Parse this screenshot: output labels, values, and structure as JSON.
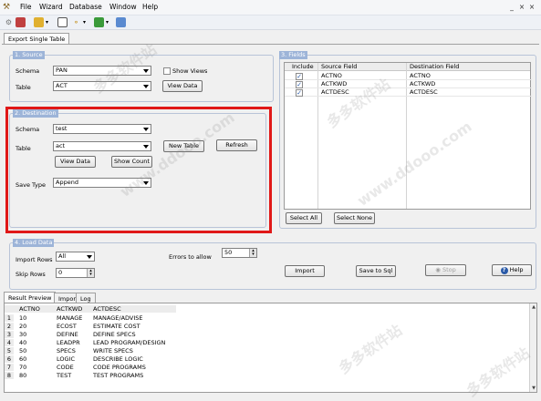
{
  "menu": {
    "items": [
      "File",
      "Wizard",
      "Database",
      "Window",
      "Help"
    ]
  },
  "window_controls": {
    "minimize": "_",
    "restore": "×",
    "close": "×"
  },
  "toolbar": {
    "icons": [
      "wrench-icon",
      "save-icon",
      "folder-icon",
      "screen-icon",
      "key-icon",
      "table-icon",
      "grid-icon"
    ]
  },
  "tabs": {
    "main": "Export Single Table"
  },
  "source": {
    "legend": "1. Source",
    "schema_label": "Schema",
    "schema_value": "PAN",
    "table_label": "Table",
    "table_value": "ACT",
    "show_views_label": "Show Views",
    "view_data_label": "View Data"
  },
  "destination": {
    "legend": "2. Destination",
    "schema_label": "Schema",
    "schema_value": "test",
    "table_label": "Table",
    "table_value": "act",
    "new_table_label": "New Table",
    "refresh_label": "Refresh",
    "view_data_label": "View Data",
    "show_count_label": "Show Count",
    "save_type_label": "Save Type",
    "save_type_value": "Append"
  },
  "fields": {
    "legend": "3. Fields",
    "columns": [
      "Include",
      "Source Field",
      "Destination Field"
    ],
    "rows": [
      {
        "include": "✓",
        "source": "ACTNO",
        "destination": "ACTNO"
      },
      {
        "include": "✓",
        "source": "ACTKWD",
        "destination": "ACTKWD"
      },
      {
        "include": "✓",
        "source": "ACTDESC",
        "destination": "ACTDESC"
      }
    ],
    "select_all_label": "Select All",
    "select_none_label": "Select None"
  },
  "load_data": {
    "legend": "4. Load Data",
    "import_rows_label": "Import Rows",
    "import_rows_value": "All",
    "skip_rows_label": "Skip Rows",
    "skip_rows_value": "0",
    "errors_label": "Errors to allow",
    "errors_value": "50",
    "import_label": "Import",
    "save_to_sql_label": "Save to Sql",
    "stop_label": "Stop",
    "help_label": "Help"
  },
  "result_tabs": [
    "Result Preview",
    "Import",
    "Log"
  ],
  "result": {
    "columns": [
      "ACTNO",
      "ACTKWD",
      "ACTDESC"
    ],
    "rows": [
      [
        "1",
        "10",
        "MANAGE",
        "MANAGE/ADVISE"
      ],
      [
        "2",
        "20",
        "ECOST",
        "ESTIMATE COST"
      ],
      [
        "3",
        "30",
        "DEFINE",
        "DEFINE SPECS"
      ],
      [
        "4",
        "40",
        "LEADPR",
        "LEAD PROGRAM/DESIGN"
      ],
      [
        "5",
        "50",
        "SPECS",
        "WRITE SPECS"
      ],
      [
        "6",
        "60",
        "LOGIC",
        "DESCRIBE LOGIC"
      ],
      [
        "7",
        "70",
        "CODE",
        "CODE PROGRAMS"
      ],
      [
        "8",
        "80",
        "TEST",
        "TEST PROGRAMS"
      ]
    ]
  },
  "watermarks": [
    "多多软件站",
    "www.ddooo.com"
  ],
  "colors": {
    "highlight": "#e01818",
    "legend_bg": "#9db4d8"
  }
}
